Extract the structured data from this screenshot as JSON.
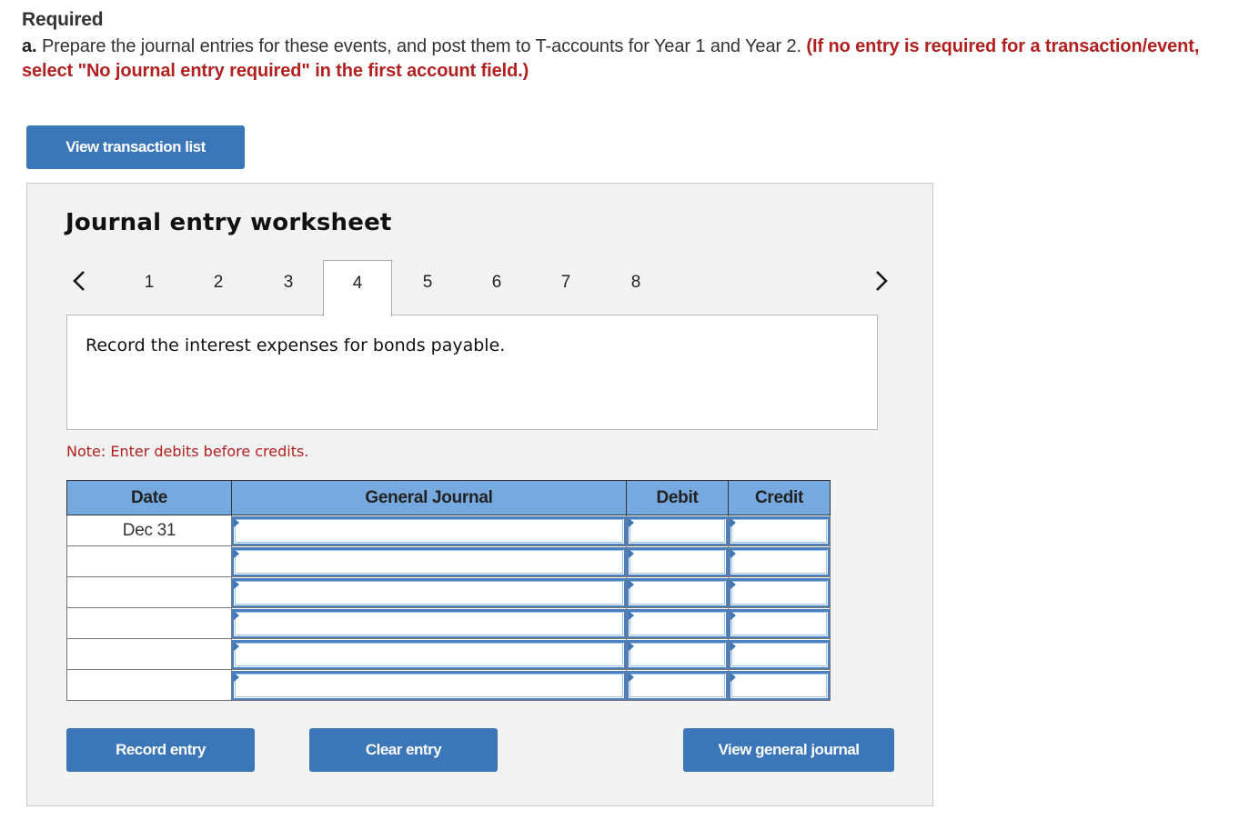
{
  "header": {
    "title": "Required",
    "part_label": "a.",
    "instruction": " Prepare the journal entries for these events, and post them to T-accounts for Year 1 and Year 2. ",
    "note": "(If no entry is required for a transaction/event, select \"No journal entry required\" in the first account field.)"
  },
  "buttons": {
    "view_transaction_list": "View transaction list",
    "record_entry": "Record entry",
    "clear_entry": "Clear entry",
    "view_general_journal": "View general journal"
  },
  "worksheet": {
    "title": "Journal entry worksheet",
    "tabs": [
      {
        "label": "1",
        "active": false
      },
      {
        "label": "2",
        "active": false
      },
      {
        "label": "3",
        "active": false
      },
      {
        "label": "4",
        "active": true
      },
      {
        "label": "5",
        "active": false
      },
      {
        "label": "6",
        "active": false
      },
      {
        "label": "7",
        "active": false
      },
      {
        "label": "8",
        "active": false
      }
    ],
    "prev_icon": "chevron-left-icon",
    "next_icon": "chevron-right-icon",
    "description": "Record the interest expenses for bonds payable.",
    "note": "Note: Enter debits before credits.",
    "table": {
      "columns": [
        "Date",
        "General Journal",
        "Debit",
        "Credit"
      ],
      "rows": [
        {
          "date": "Dec 31",
          "account": "",
          "debit": "",
          "credit": ""
        },
        {
          "date": "",
          "account": "",
          "debit": "",
          "credit": ""
        },
        {
          "date": "",
          "account": "",
          "debit": "",
          "credit": ""
        },
        {
          "date": "",
          "account": "",
          "debit": "",
          "credit": ""
        },
        {
          "date": "",
          "account": "",
          "debit": "",
          "credit": ""
        },
        {
          "date": "",
          "account": "",
          "debit": "",
          "credit": ""
        }
      ]
    }
  },
  "colors": {
    "button_bg": "#3a76b8",
    "header_bg": "#76a9e0",
    "alert_red": "#b21f1f",
    "panel_bg": "#f2f2f2"
  }
}
